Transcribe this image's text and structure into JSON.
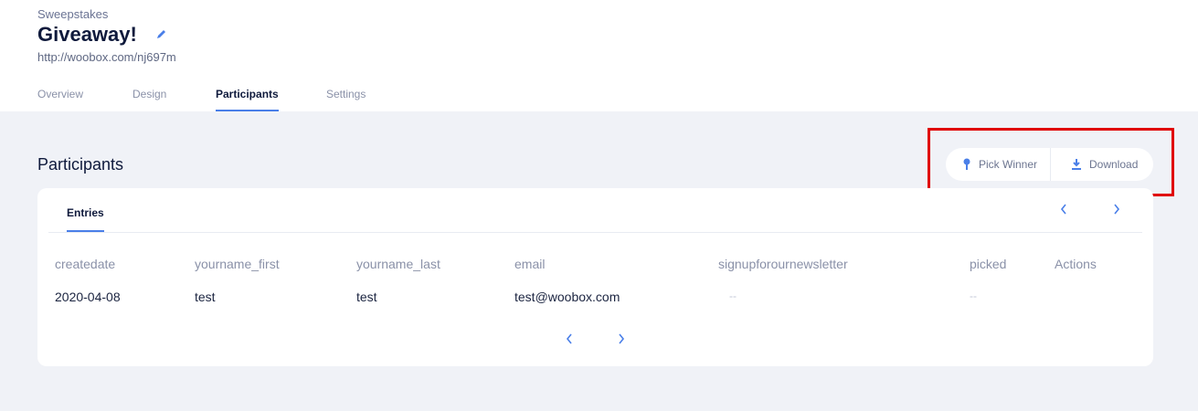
{
  "header": {
    "kind": "Sweepstakes",
    "title": "Giveaway!",
    "url": "http://woobox.com/nj697m",
    "icon_edit": "pencil-icon"
  },
  "tabs": [
    {
      "label": "Overview",
      "active": false
    },
    {
      "label": "Design",
      "active": false
    },
    {
      "label": "Participants",
      "active": true
    },
    {
      "label": "Settings",
      "active": false
    }
  ],
  "section": {
    "title": "Participants"
  },
  "actions": {
    "pick_winner": "Pick Winner",
    "pick_icon": "pin-icon",
    "download": "Download",
    "download_icon": "download-icon"
  },
  "card": {
    "tab": "Entries",
    "columns": [
      "createdate",
      "yourname_first",
      "yourname_last",
      "email",
      "signupforournewsletter",
      "picked",
      "Actions"
    ],
    "rows": [
      {
        "createdate": "2020-04-08",
        "yourname_first": "test",
        "yourname_last": "test",
        "email": "test@woobox.com",
        "signupforournewsletter": "--",
        "picked": "--",
        "actions": ""
      }
    ]
  },
  "colors": {
    "accent": "#4a7fe8",
    "highlight": "#e00000",
    "background": "#f0f2f7",
    "title": "#0f1a3c"
  }
}
